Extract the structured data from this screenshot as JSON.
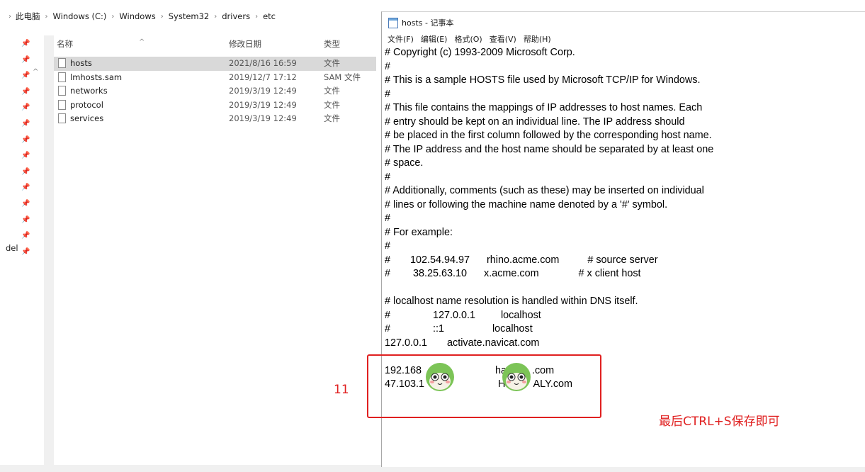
{
  "explorer": {
    "breadcrumb": [
      "此电脑",
      "Windows (C:)",
      "Windows",
      "System32",
      "drivers",
      "etc"
    ],
    "nav_label": "del",
    "columns": {
      "name": "名称",
      "date": "修改日期",
      "type": "类型"
    },
    "files": [
      {
        "name": "hosts",
        "date": "2021/8/16 16:59",
        "type": "文件",
        "selected": true
      },
      {
        "name": "lmhosts.sam",
        "date": "2019/12/7 17:12",
        "type": "SAM 文件",
        "selected": false
      },
      {
        "name": "networks",
        "date": "2019/3/19 12:49",
        "type": "文件",
        "selected": false
      },
      {
        "name": "protocol",
        "date": "2019/3/19 12:49",
        "type": "文件",
        "selected": false
      },
      {
        "name": "services",
        "date": "2019/3/19 12:49",
        "type": "文件",
        "selected": false
      }
    ]
  },
  "notepad": {
    "title": "hosts - 记事本",
    "menu": [
      "文件(F)",
      "编辑(E)",
      "格式(O)",
      "查看(V)",
      "帮助(H)"
    ],
    "content": "# Copyright (c) 1993-2009 Microsoft Corp.\n#\n# This is a sample HOSTS file used by Microsoft TCP/IP for Windows.\n#\n# This file contains the mappings of IP addresses to host names. Each\n# entry should be kept on an individual line. The IP address should\n# be placed in the first column followed by the corresponding host name.\n# The IP address and the host name should be separated by at least one\n# space.\n#\n# Additionally, comments (such as these) may be inserted on individual\n# lines or following the machine name denoted by a '#' symbol.\n#\n# For example:\n#\n#       102.54.94.97      rhino.acme.com          # source server\n#        38.25.63.10      x.acme.com              # x client host\n\n# localhost name resolution is handled within DNS itself.\n#               127.0.0.1         localhost\n#               ::1                 localhost\n127.0.0.1       activate.navicat.com\n\n192.168                          ha         .com\n47.103.1                          H          ALY.com"
  },
  "annotations": {
    "label_11": "11",
    "save_hint": "最后CTRL+S保存即可",
    "accent_color": "#e02020"
  }
}
